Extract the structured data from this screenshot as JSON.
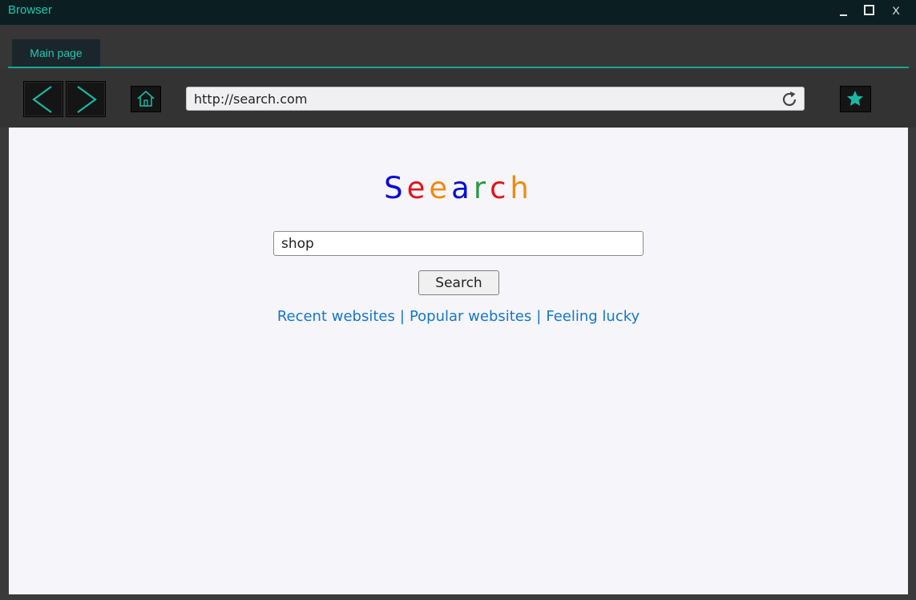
{
  "window": {
    "title": "Browser",
    "minimize_icon": "minimize-icon",
    "maximize_icon": "maximize-icon",
    "close_label": "X"
  },
  "tabs": [
    {
      "label": "Main page",
      "active": true
    }
  ],
  "toolbar": {
    "back_icon": "chevron-left-icon",
    "forward_icon": "chevron-right-icon",
    "home_icon": "home-icon",
    "url": "http://search.com",
    "reload_icon": "reload-icon",
    "bookmark_icon": "star-icon"
  },
  "page": {
    "logo": {
      "letters": [
        {
          "char": "S",
          "color": "#0a0ad6"
        },
        {
          "char": "e",
          "color": "#e3131b"
        },
        {
          "char": "e",
          "color": "#ef8a16"
        },
        {
          "char": "a",
          "color": "#0a0ad6"
        },
        {
          "char": "r",
          "color": "#2e9848"
        },
        {
          "char": "c",
          "color": "#e3131b"
        },
        {
          "char": "h",
          "color": "#ef8a16"
        }
      ]
    },
    "search_value": "shop",
    "search_button_label": "Search",
    "links": [
      {
        "label": "Recent websites"
      },
      {
        "label": "Popular websites"
      },
      {
        "label": "Feeling lucky"
      }
    ],
    "link_separator": "|"
  },
  "colors": {
    "accent": "#1ec9b0",
    "link": "#1477c8",
    "titlebar": "#0b1f22",
    "content_bg": "#f6f5f9"
  }
}
